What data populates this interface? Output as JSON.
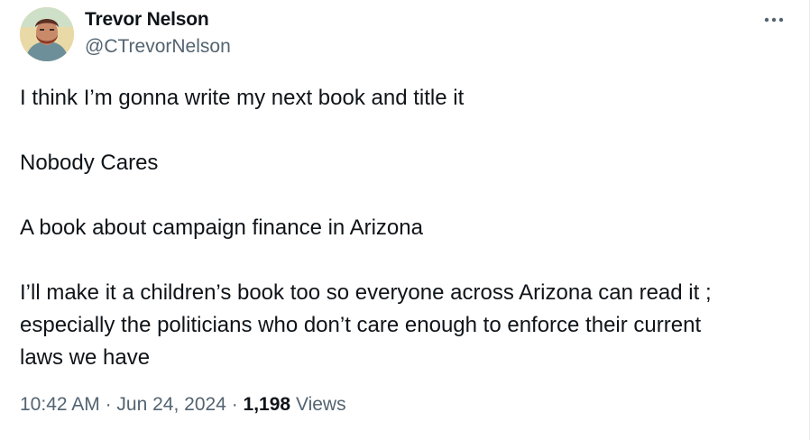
{
  "author": {
    "name": "Trevor Nelson",
    "handle": "@CTrevorNelson",
    "avatar_icon": "profile-photo"
  },
  "more_icon": "more-dots-icon",
  "tweet": {
    "lines": [
      "I think I’m gonna write my next book and title it",
      "",
      "Nobody Cares",
      "",
      "A book about campaign finance in Arizona",
      "",
      "I’ll make it a children’s book too so everyone across Arizona can read it ;",
      "especially the politicians who don’t care enough to enforce their current",
      "laws we have"
    ]
  },
  "meta": {
    "time": "10:42 AM",
    "separator": "·",
    "date": "Jun 24, 2024",
    "views_count": "1,198",
    "views_label": "Views"
  },
  "colors": {
    "primary_text": "#0f1419",
    "secondary_text": "#536471"
  }
}
